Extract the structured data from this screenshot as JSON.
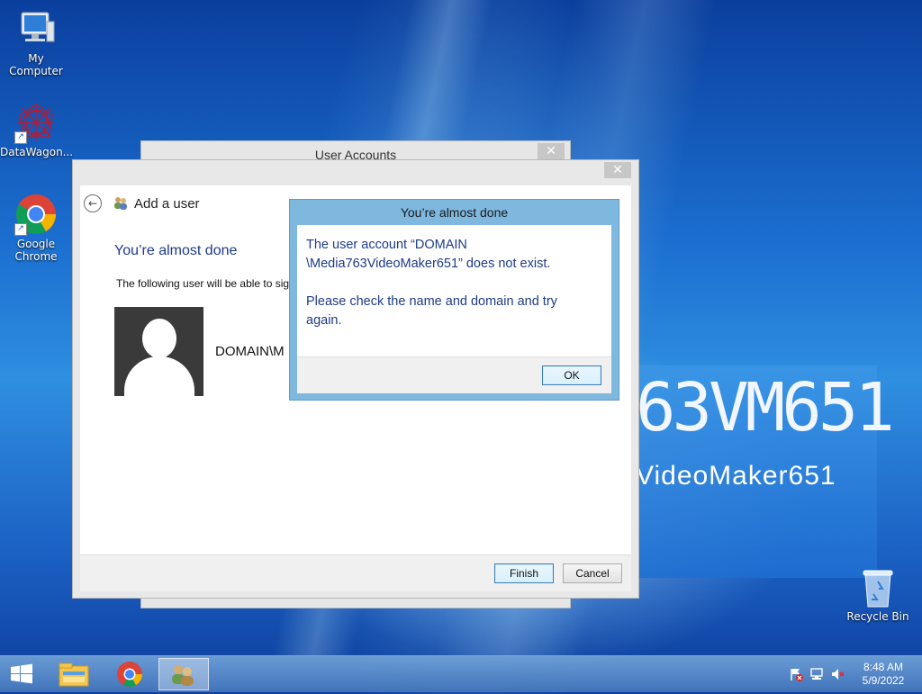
{
  "desktop": {
    "icons": [
      {
        "label": "My Computer",
        "icon": "computer-icon"
      },
      {
        "label": "DataWagon...",
        "icon": "datawagon-icon"
      },
      {
        "label": "Google\nChrome",
        "icon": "chrome-icon"
      },
      {
        "label": "Recycle Bin",
        "icon": "recycle-bin-icon"
      }
    ],
    "wallpaper": {
      "code_text": "63VM651",
      "name_text": "VideoMaker651"
    }
  },
  "back_window": {
    "title": "User Accounts"
  },
  "wizard": {
    "nav_title": "Add a user",
    "heading": "You’re almost done",
    "following_text": "The following user will be able to sig",
    "username": "DOMAIN\\M",
    "finish_label": "Finish",
    "cancel_label": "Cancel"
  },
  "message_box": {
    "title": "You’re almost done",
    "line1": "The user account “DOMAIN",
    "line2": "\\Media763VideoMaker651” does not exist.",
    "line3": "Please check the name and domain and try",
    "line4": "again.",
    "ok_label": "OK"
  },
  "taskbar": {
    "items": [
      "start-button",
      "file-explorer",
      "google-chrome",
      "user-accounts"
    ],
    "clock_time": "8:48 AM",
    "clock_date": "5/9/2022"
  },
  "colors": {
    "accent_text": "#1e3a8a",
    "dialog_frame": "#7fb8df"
  }
}
